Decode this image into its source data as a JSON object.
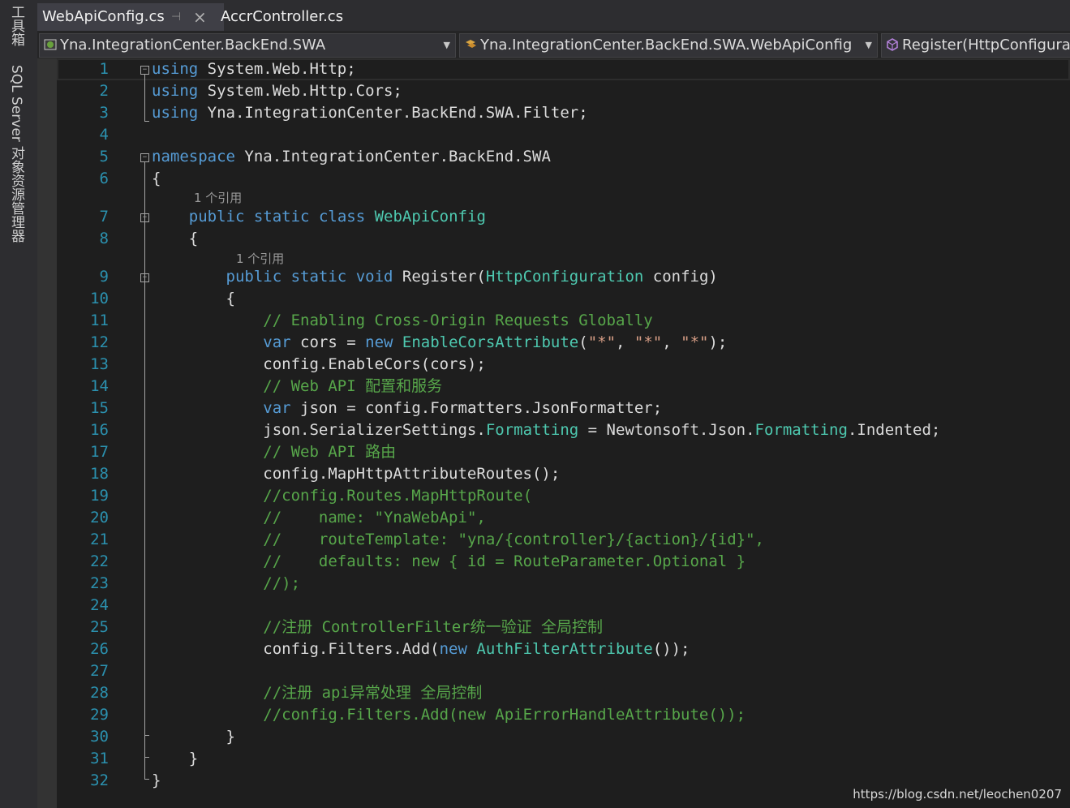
{
  "sidebar": {
    "tabs": [
      {
        "label": "工具箱"
      },
      {
        "label": "SQL Server 对象资源管理器"
      }
    ]
  },
  "tabs": [
    {
      "label": "WebApiConfig.cs",
      "active": true
    },
    {
      "label": "AccrController.cs",
      "active": false
    }
  ],
  "navbar": {
    "project": "Yna.IntegrationCenter.BackEnd.SWA",
    "class": "Yna.IntegrationCenter.BackEnd.SWA.WebApiConfig",
    "member": "Register(HttpConfiguration config)"
  },
  "code_lens": {
    "class_refs": "1 个引用",
    "method_refs": "1 个引用"
  },
  "lines": [
    "using System.Web.Http;",
    "using System.Web.Http.Cors;",
    "using Yna.IntegrationCenter.BackEnd.SWA.Filter;",
    "",
    "namespace Yna.IntegrationCenter.BackEnd.SWA",
    "{",
    "    public static class WebApiConfig",
    "    {",
    "        public static void Register(HttpConfiguration config)",
    "        {",
    "            // Enabling Cross-Origin Requests Globally",
    "            var cors = new EnableCorsAttribute(\"*\", \"*\", \"*\");",
    "            config.EnableCors(cors);",
    "            // Web API 配置和服务",
    "            var json = config.Formatters.JsonFormatter;",
    "            json.SerializerSettings.Formatting = Newtonsoft.Json.Formatting.Indented;",
    "            // Web API 路由",
    "            config.MapHttpAttributeRoutes();",
    "            //config.Routes.MapHttpRoute(",
    "            //    name: \"YnaWebApi\",",
    "            //    routeTemplate: \"yna/{controller}/{action}/{id}\",",
    "            //    defaults: new { id = RouteParameter.Optional }",
    "            //);",
    "",
    "            //注册 ControllerFilter统一验证 全局控制",
    "            config.Filters.Add(new AuthFilterAttribute());",
    "",
    "            //注册 api异常处理 全局控制",
    "            //config.Filters.Add(new ApiErrorHandleAttribute());",
    "        }",
    "    }",
    "}"
  ],
  "watermark": "https://blog.csdn.net/leochen0207",
  "colors": {
    "keyword": "#569cd6",
    "type": "#4ec9b0",
    "comment": "#57a64a",
    "string": "#d69d85",
    "line_number": "#2b91af",
    "text": "#dcdcdc"
  }
}
